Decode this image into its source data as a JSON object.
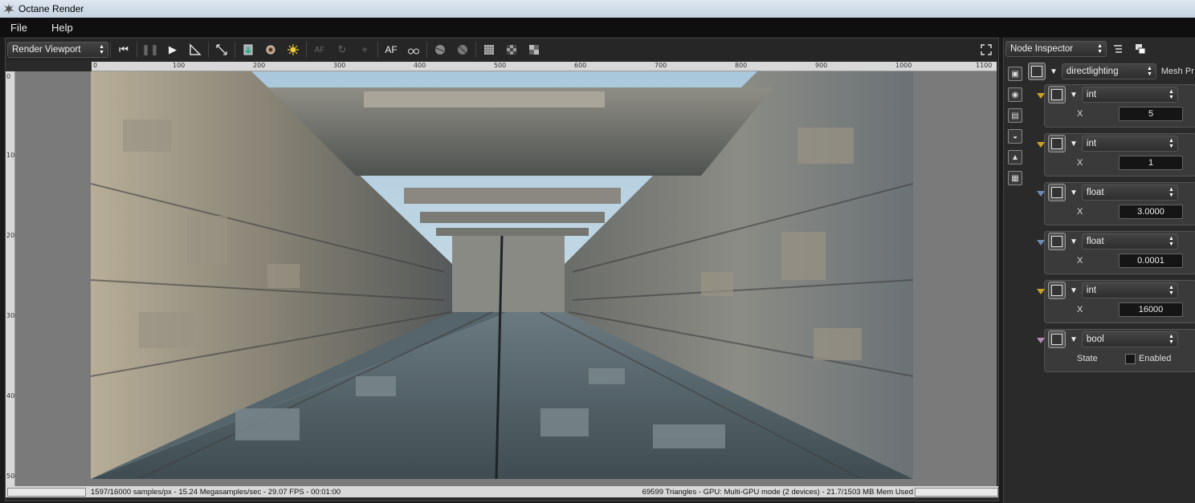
{
  "window": {
    "title": "Octane Render"
  },
  "menu": [
    "File",
    "Help"
  ],
  "viewport": {
    "selector": "Render Viewport",
    "ruler_h": [
      "0",
      "100",
      "200",
      "300",
      "400",
      "500",
      "600",
      "700",
      "800",
      "900",
      "1000",
      "1100"
    ],
    "ruler_v": [
      "0",
      "100",
      "200",
      "300",
      "400",
      "500"
    ],
    "status_left": "1597/16000 samples/px - 15.24 Megasamples/sec - 29.07 FPS - 00:01:00",
    "status_right": "69599 Triangles - GPU: Multi-GPU mode (2 devices) - 21.7/1503 MB Mem Used",
    "toolbar_af": "AF"
  },
  "inspector": {
    "selector": "Node Inspector",
    "node_name": "directlighting",
    "node_extra": "Mesh Pr",
    "params": [
      {
        "type": "int",
        "xlabel": "X",
        "value": "5",
        "pin": "#c9a02c"
      },
      {
        "type": "int",
        "xlabel": "X",
        "value": "1",
        "pin": "#c9a02c"
      },
      {
        "type": "float",
        "xlabel": "X",
        "value": "3.0000",
        "pin": "#6f8ab0"
      },
      {
        "type": "float",
        "xlabel": "X",
        "value": "0.0001",
        "pin": "#6f8ab0"
      },
      {
        "type": "int",
        "xlabel": "X",
        "value": "16000",
        "pin": "#c9a02c"
      }
    ],
    "bool_param": {
      "type": "bool",
      "state_label": "State",
      "check_label": "Enabled",
      "pin": "#b58ab5"
    }
  }
}
